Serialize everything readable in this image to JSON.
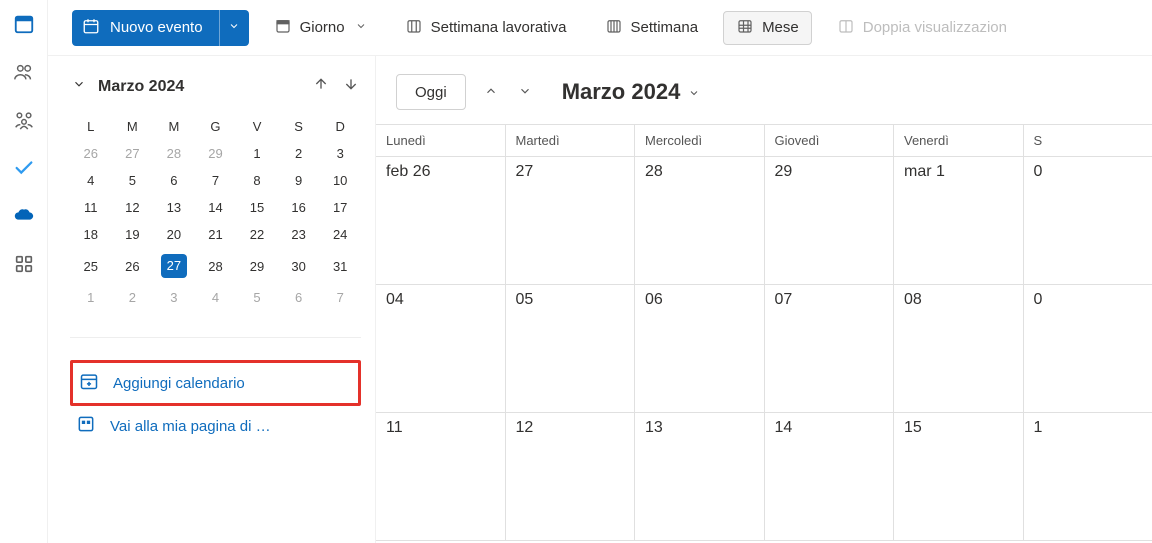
{
  "toolbar": {
    "new_event_label": "Nuovo evento",
    "view_day": "Giorno",
    "view_workweek": "Settimana lavorativa",
    "view_week": "Settimana",
    "view_month": "Mese",
    "view_split": "Doppia visualizzazion"
  },
  "mini": {
    "title": "Marzo 2024",
    "dow": [
      "L",
      "M",
      "M",
      "G",
      "V",
      "S",
      "D"
    ],
    "rows": [
      [
        {
          "d": "26",
          "o": true
        },
        {
          "d": "27",
          "o": true
        },
        {
          "d": "28",
          "o": true
        },
        {
          "d": "29",
          "o": true
        },
        {
          "d": "1"
        },
        {
          "d": "2"
        },
        {
          "d": "3"
        }
      ],
      [
        {
          "d": "4"
        },
        {
          "d": "5"
        },
        {
          "d": "6"
        },
        {
          "d": "7"
        },
        {
          "d": "8"
        },
        {
          "d": "9"
        },
        {
          "d": "10"
        }
      ],
      [
        {
          "d": "11"
        },
        {
          "d": "12"
        },
        {
          "d": "13"
        },
        {
          "d": "14"
        },
        {
          "d": "15"
        },
        {
          "d": "16"
        },
        {
          "d": "17"
        }
      ],
      [
        {
          "d": "18"
        },
        {
          "d": "19"
        },
        {
          "d": "20"
        },
        {
          "d": "21"
        },
        {
          "d": "22"
        },
        {
          "d": "23"
        },
        {
          "d": "24"
        }
      ],
      [
        {
          "d": "25"
        },
        {
          "d": "26"
        },
        {
          "d": "27",
          "sel": true
        },
        {
          "d": "28"
        },
        {
          "d": "29"
        },
        {
          "d": "30"
        },
        {
          "d": "31"
        }
      ],
      [
        {
          "d": "1",
          "o": true
        },
        {
          "d": "2",
          "o": true
        },
        {
          "d": "3",
          "o": true
        },
        {
          "d": "4",
          "o": true
        },
        {
          "d": "5",
          "o": true
        },
        {
          "d": "6",
          "o": true
        },
        {
          "d": "7",
          "o": true
        }
      ]
    ]
  },
  "sidelinks": {
    "add_calendar": "Aggiungi calendario",
    "bookings": "Vai alla mia pagina di …"
  },
  "calendar": {
    "today_label": "Oggi",
    "title": "Marzo 2024",
    "dow": [
      "Lunedì",
      "Martedì",
      "Mercoledì",
      "Giovedì",
      "Venerdì",
      "S"
    ],
    "weeks": [
      [
        "feb 26",
        "27",
        "28",
        "29",
        "mar 1",
        "0"
      ],
      [
        "04",
        "05",
        "06",
        "07",
        "08",
        "0"
      ],
      [
        "11",
        "12",
        "13",
        "14",
        "15",
        "1"
      ]
    ]
  }
}
